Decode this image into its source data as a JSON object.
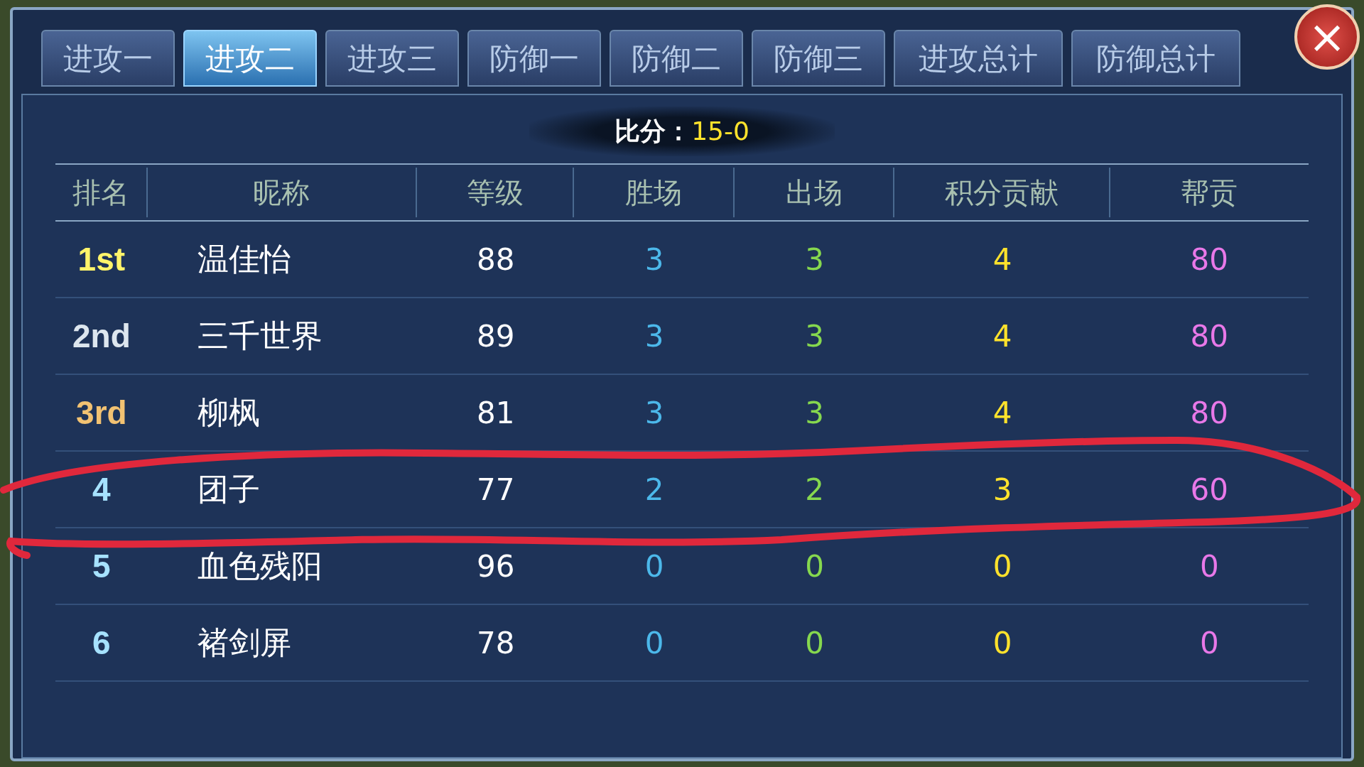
{
  "tabs": [
    {
      "label": "进攻一",
      "selected": false
    },
    {
      "label": "进攻二",
      "selected": true
    },
    {
      "label": "进攻三",
      "selected": false
    },
    {
      "label": "防御一",
      "selected": false
    },
    {
      "label": "防御二",
      "selected": false
    },
    {
      "label": "防御三",
      "selected": false
    },
    {
      "label": "进攻总计",
      "selected": false
    },
    {
      "label": "防御总计",
      "selected": false
    }
  ],
  "close_button": "×",
  "score": {
    "label": "比分：",
    "value": "15-0"
  },
  "table": {
    "columns": [
      {
        "label": "排名"
      },
      {
        "label": "昵称"
      },
      {
        "label": "等级"
      },
      {
        "label": "胜场",
        "color": "#4cb8ea"
      },
      {
        "label": "出场",
        "color": "#86d84e"
      },
      {
        "label": "积分贡献",
        "color": "#ffe22c"
      },
      {
        "label": "帮贡",
        "color": "#e878e8"
      }
    ],
    "rows": [
      {
        "color": "#fff46a",
        "cells": [
          "1st",
          "温佳怡",
          "88",
          "3",
          "3",
          "4",
          "80"
        ]
      },
      {
        "color": "#dde6ee",
        "cells": [
          "2nd",
          "三千世界",
          "89",
          "3",
          "3",
          "4",
          "80"
        ]
      },
      {
        "color": "#f2c272",
        "cells": [
          "3rd",
          "柳枫",
          "81",
          "3",
          "3",
          "4",
          "80"
        ]
      },
      {
        "color": "#a6e2ff",
        "cells": [
          "4",
          "团子",
          "77",
          "2",
          "2",
          "3",
          "60"
        ]
      },
      {
        "color": "#a6e2ff",
        "cells": [
          "5",
          "血色残阳",
          "96",
          "0",
          "0",
          "0",
          "0"
        ]
      },
      {
        "color": "#a6e2ff",
        "cells": [
          "6",
          "褚剑屏",
          "78",
          "0",
          "0",
          "0",
          "0"
        ]
      }
    ]
  },
  "annotation": {
    "kind": "scribble",
    "color": "#e0283c"
  }
}
